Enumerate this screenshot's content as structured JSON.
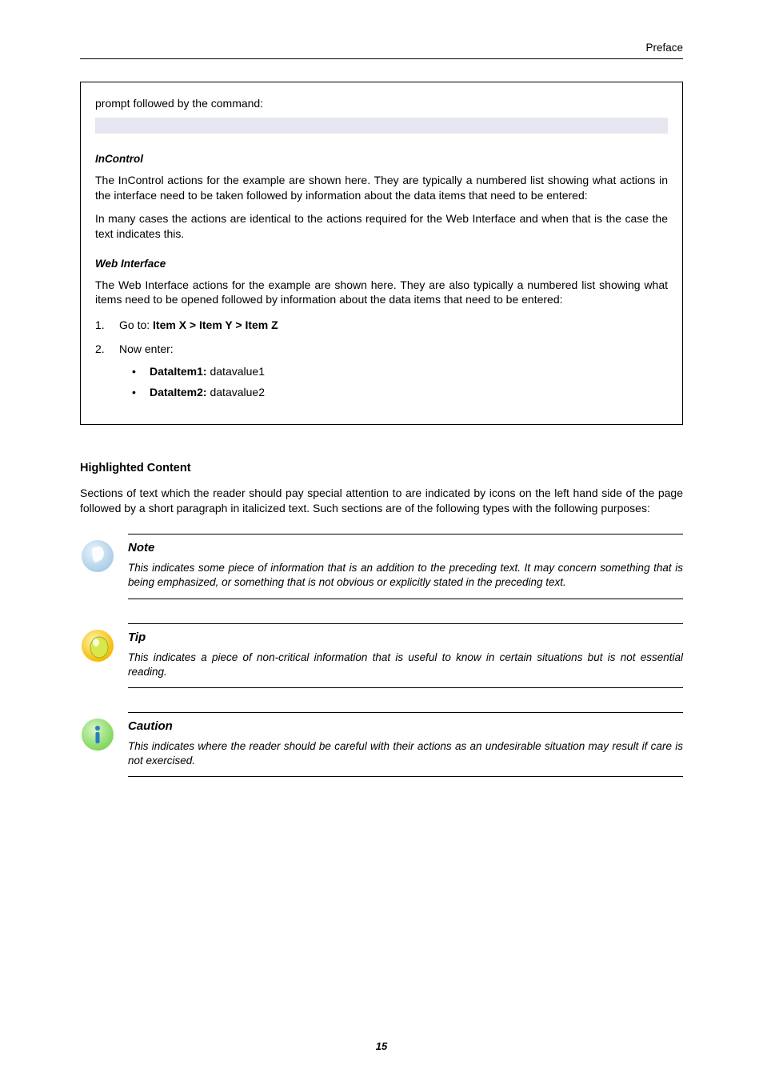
{
  "header": {
    "section": "Preface"
  },
  "example": {
    "prompt_line": "prompt followed by the command:",
    "incontrol": {
      "heading": "InControl",
      "p1": "The InControl actions for the example are shown here. They are typically a numbered list showing what actions in the interface need to be taken followed by information about the data items that need to be entered:",
      "p2": "In many cases the actions are identical to the actions required for the Web Interface and when that is the case the text indicates this."
    },
    "web": {
      "heading": "Web Interface",
      "p1": "The Web Interface actions for the example are shown here. They are also typically a numbered list showing what items need to be opened followed by information about the data items that need to be entered:",
      "step1": {
        "num": "1.",
        "text_prefix": "Go to: ",
        "bold": "Item X > Item Y > Item Z"
      },
      "step2": {
        "num": "2.",
        "text": "Now enter:",
        "items": [
          {
            "label": "DataItem1:",
            "value": " datavalue1"
          },
          {
            "label": "DataItem2:",
            "value": " datavalue2"
          }
        ]
      }
    }
  },
  "highlighted": {
    "heading": "Highlighted Content",
    "intro": "Sections of text which the reader should pay special attention to are indicated by icons on the left hand side of the page followed by a short paragraph in italicized text. Such sections are of the following types with the following purposes:"
  },
  "callouts": {
    "note": {
      "title": "Note",
      "desc": "This indicates some piece of information that is an addition to the preceding text. It may concern something that is being emphasized, or something that is not obvious or explicitly stated in the preceding text."
    },
    "tip": {
      "title": "Tip",
      "desc": "This indicates a piece of non-critical information that is useful to know in certain situations but is not essential reading."
    },
    "caution": {
      "title": "Caution",
      "desc": "This indicates where the reader should be careful with their actions as an undesirable situation may result if care is not exercised."
    }
  },
  "page_number": "15"
}
